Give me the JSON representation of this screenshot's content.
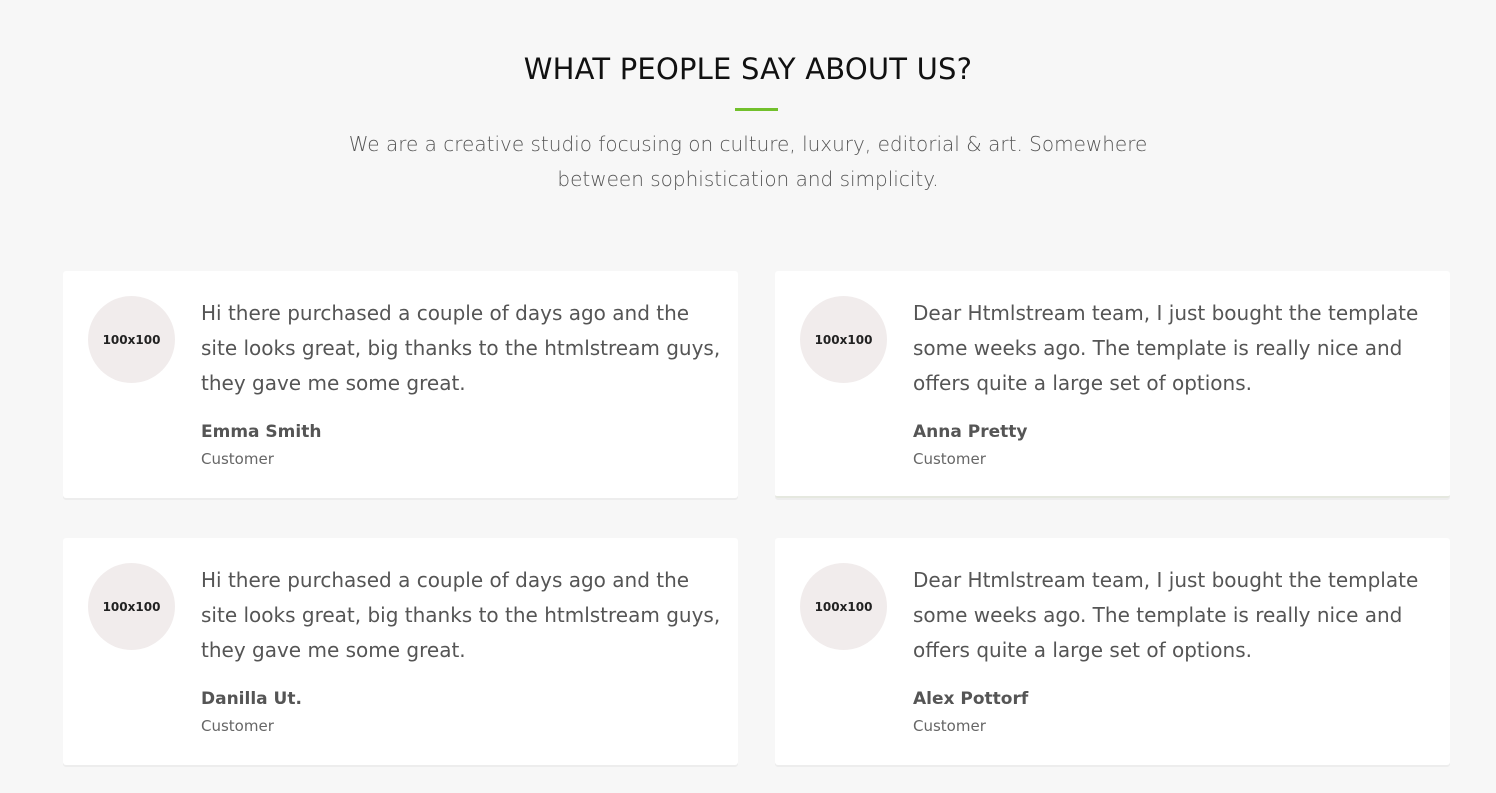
{
  "header": {
    "title": "WHAT PEOPLE SAY ABOUT US?",
    "subtitle": "We are a creative studio focusing on culture, luxury, editorial & art. Somewhere between sophistication and simplicity.",
    "accent_color": "#72c02c"
  },
  "testimonials": [
    {
      "avatar_label": "100x100",
      "quote": "Hi there purchased a couple of days ago and the site looks great, big thanks to the htmlstream guys, they gave me some great.",
      "name": "Emma Smith",
      "role": "Customer"
    },
    {
      "avatar_label": "100x100",
      "quote": "Dear Htmlstream team, I just bought the template some weeks ago. The template is really nice and offers quite a large set of options.",
      "name": "Anna Pretty",
      "role": "Customer"
    },
    {
      "avatar_label": "100x100",
      "quote": "Hi there purchased a couple of days ago and the site looks great, big thanks to the htmlstream guys, they gave me some great.",
      "name": "Danilla Ut.",
      "role": "Customer"
    },
    {
      "avatar_label": "100x100",
      "quote": "Dear Htmlstream team, I just bought the template some weeks ago. The template is really nice and offers quite a large set of options.",
      "name": "Alex Pottorf",
      "role": "Customer"
    }
  ]
}
